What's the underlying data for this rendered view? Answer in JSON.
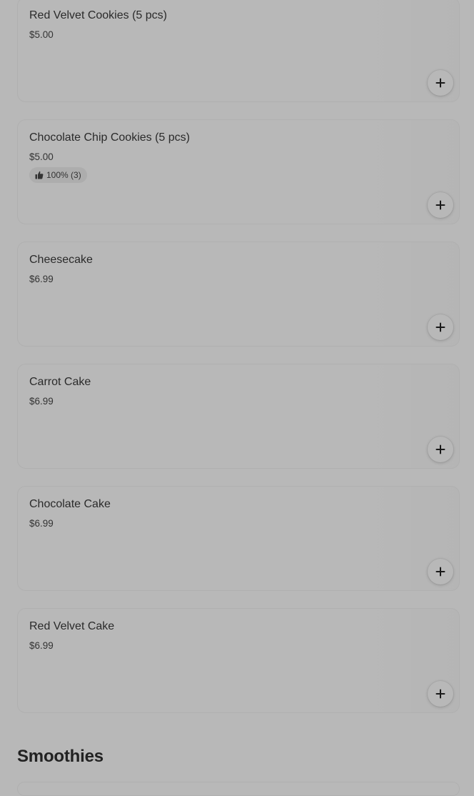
{
  "menu_items": [
    {
      "name": "Red Velvet Cookies (5 pcs)",
      "price": "$5.00",
      "rating": null
    },
    {
      "name": "Chocolate Chip Cookies (5 pcs)",
      "price": "$5.00",
      "rating": "100% (3)"
    },
    {
      "name": "Cheesecake",
      "price": "$6.99",
      "rating": null
    },
    {
      "name": "Carrot Cake",
      "price": "$6.99",
      "rating": null
    },
    {
      "name": "Chocolate Cake",
      "price": "$6.99",
      "rating": null
    },
    {
      "name": "Red Velvet Cake",
      "price": "$6.99",
      "rating": null
    }
  ],
  "next_section": {
    "title": "Smoothies"
  },
  "icons": {
    "add": "plus-icon",
    "rating": "thumbs-up-icon"
  },
  "colors": {
    "overlay_background": "#b8b8b8",
    "text_primary": "#2a2a2a"
  }
}
